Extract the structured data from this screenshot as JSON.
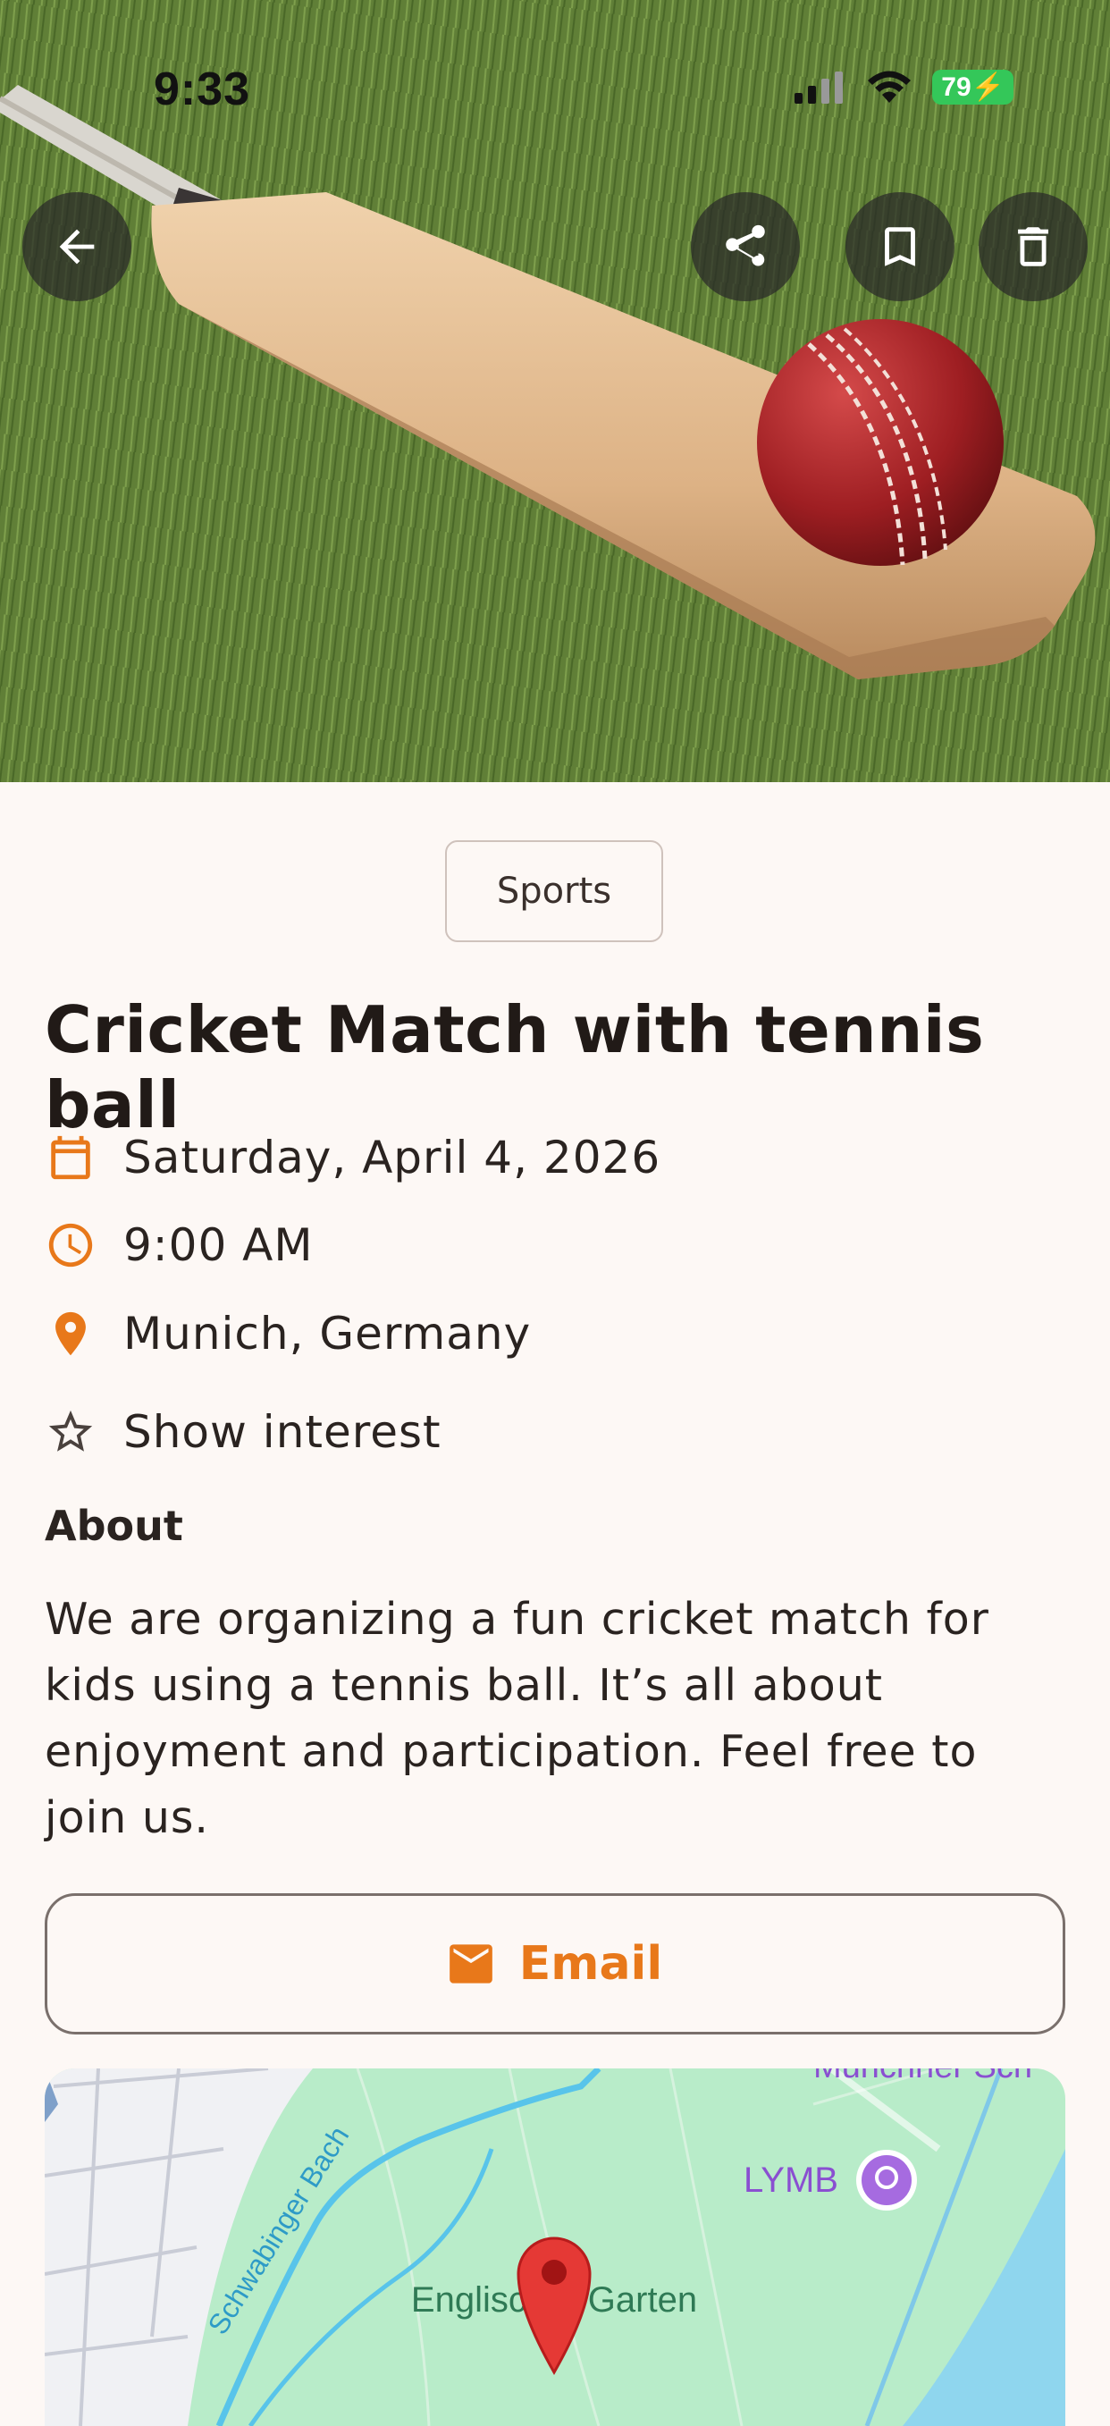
{
  "status_bar": {
    "time": "9:33",
    "battery": "79"
  },
  "hero": {
    "back_icon": "arrow-left-icon",
    "share_icon": "share-icon",
    "bookmark_icon": "bookmark-icon",
    "delete_icon": "trash-icon"
  },
  "event": {
    "category": "Sports",
    "title": "Cricket Match with tennis ball",
    "date": "Saturday, April 4, 2026",
    "time": "9:00 AM",
    "location": "Munich, Germany",
    "interest_label": "Show interest"
  },
  "about": {
    "heading": "About",
    "text": "We are organizing a fun cricket match for kids using a tennis ball. It’s all about enjoyment and participation. Feel free to join us."
  },
  "email_button": {
    "label": "Email"
  },
  "map": {
    "labels": {
      "stream": "Schwabinger Bach",
      "park": "Englischer Garten",
      "poi": "LYMB",
      "top": "Münchner Sch"
    }
  },
  "colors": {
    "accent": "#e8781a",
    "background": "#fdf8f5"
  }
}
